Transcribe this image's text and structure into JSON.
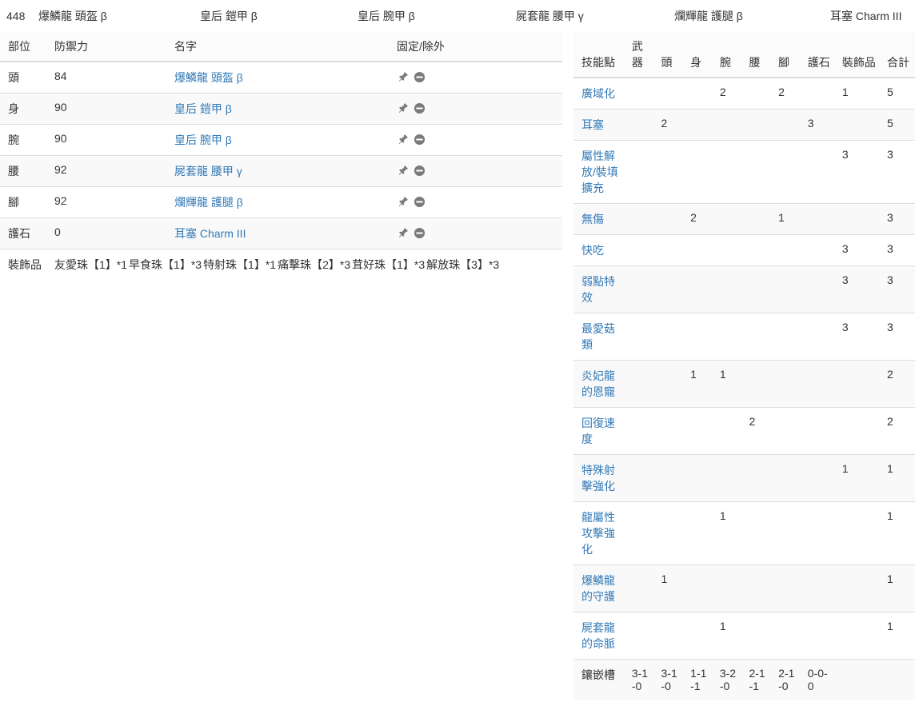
{
  "topbar": {
    "defense_total": "448",
    "pieces": [
      "爆鱗龍 頭盔 β",
      "皇后 鎧甲 β",
      "皇后 腕甲 β",
      "屍套龍 腰甲 γ",
      "爛輝龍 護腿 β",
      "耳塞 Charm III"
    ]
  },
  "equipment_table": {
    "headers": [
      "部位",
      "防禦力",
      "名字",
      "固定/除外"
    ],
    "rows": [
      {
        "part": "頭",
        "defense": "84",
        "name": "爆鱗龍 頭盔 β",
        "pin": "pin-icon",
        "exclude": "ban-icon"
      },
      {
        "part": "身",
        "defense": "90",
        "name": "皇后 鎧甲 β",
        "pin": "pin-icon",
        "exclude": "ban-icon"
      },
      {
        "part": "腕",
        "defense": "90",
        "name": "皇后 腕甲 β",
        "pin": "pin-icon",
        "exclude": "ban-icon"
      },
      {
        "part": "腰",
        "defense": "92",
        "name": "屍套龍 腰甲 γ",
        "pin": "pin-icon",
        "exclude": "ban-icon"
      },
      {
        "part": "腳",
        "defense": "92",
        "name": "爛輝龍 護腿 β",
        "pin": "pin-icon",
        "exclude": "ban-icon"
      },
      {
        "part": "護石",
        "defense": "0",
        "name": "耳塞 Charm III",
        "pin": "pin-icon",
        "exclude": "ban-icon"
      }
    ],
    "decorations_label": "裝飾品",
    "decorations": [
      "友愛珠【1】*1",
      "早食珠【1】*3",
      "特射珠【1】*1",
      "痛擊珠【2】*3",
      "茸好珠【1】*3",
      "解放珠【3】*3"
    ]
  },
  "skill_table": {
    "headers": [
      "技能點",
      "武器",
      "頭",
      "身",
      "腕",
      "腰",
      "腳",
      "護石",
      "裝飾品",
      "合計"
    ],
    "rows": [
      {
        "skill": "廣域化",
        "weapon": "",
        "head": "",
        "body": "",
        "arms": "2",
        "waist": "",
        "legs": "2",
        "charm": "",
        "deco": "1",
        "total": "5"
      },
      {
        "skill": "耳塞",
        "weapon": "",
        "head": "2",
        "body": "",
        "arms": "",
        "waist": "",
        "legs": "",
        "charm": "3",
        "deco": "",
        "total": "5"
      },
      {
        "skill": "屬性解放/裝填擴充",
        "weapon": "",
        "head": "",
        "body": "",
        "arms": "",
        "waist": "",
        "legs": "",
        "charm": "",
        "deco": "3",
        "total": "3"
      },
      {
        "skill": "無傷",
        "weapon": "",
        "head": "",
        "body": "2",
        "arms": "",
        "waist": "",
        "legs": "1",
        "charm": "",
        "deco": "",
        "total": "3"
      },
      {
        "skill": "快吃",
        "weapon": "",
        "head": "",
        "body": "",
        "arms": "",
        "waist": "",
        "legs": "",
        "charm": "",
        "deco": "3",
        "total": "3"
      },
      {
        "skill": "弱點特效",
        "weapon": "",
        "head": "",
        "body": "",
        "arms": "",
        "waist": "",
        "legs": "",
        "charm": "",
        "deco": "3",
        "total": "3"
      },
      {
        "skill": "最愛菇類",
        "weapon": "",
        "head": "",
        "body": "",
        "arms": "",
        "waist": "",
        "legs": "",
        "charm": "",
        "deco": "3",
        "total": "3"
      },
      {
        "skill": "炎妃龍的恩寵",
        "weapon": "",
        "head": "",
        "body": "1",
        "arms": "1",
        "waist": "",
        "legs": "",
        "charm": "",
        "deco": "",
        "total": "2"
      },
      {
        "skill": "回復速度",
        "weapon": "",
        "head": "",
        "body": "",
        "arms": "",
        "waist": "2",
        "legs": "",
        "charm": "",
        "deco": "",
        "total": "2"
      },
      {
        "skill": "特殊射擊強化",
        "weapon": "",
        "head": "",
        "body": "",
        "arms": "",
        "waist": "",
        "legs": "",
        "charm": "",
        "deco": "1",
        "total": "1"
      },
      {
        "skill": "龍屬性攻擊強化",
        "weapon": "",
        "head": "",
        "body": "",
        "arms": "1",
        "waist": "",
        "legs": "",
        "charm": "",
        "deco": "",
        "total": "1"
      },
      {
        "skill": "爆鱗龍的守護",
        "weapon": "",
        "head": "1",
        "body": "",
        "arms": "",
        "waist": "",
        "legs": "",
        "charm": "",
        "deco": "",
        "total": "1"
      },
      {
        "skill": "屍套龍的命脈",
        "weapon": "",
        "head": "",
        "body": "",
        "arms": "1",
        "waist": "",
        "legs": "",
        "charm": "",
        "deco": "",
        "total": "1"
      }
    ],
    "slots_label": "鑲嵌槽",
    "slots": {
      "weapon": "3-1-0",
      "head": "3-1-0",
      "body": "1-1-1",
      "arms": "3-2-0",
      "waist": "2-1-1",
      "legs": "2-1-0",
      "charm": "0-0-0",
      "deco": "",
      "total": ""
    }
  },
  "colors": {
    "link": "#337ab7",
    "border": "#dddddd",
    "stripe": "#f9f9f9",
    "text": "#333333",
    "icon": "#7b7b7b"
  }
}
